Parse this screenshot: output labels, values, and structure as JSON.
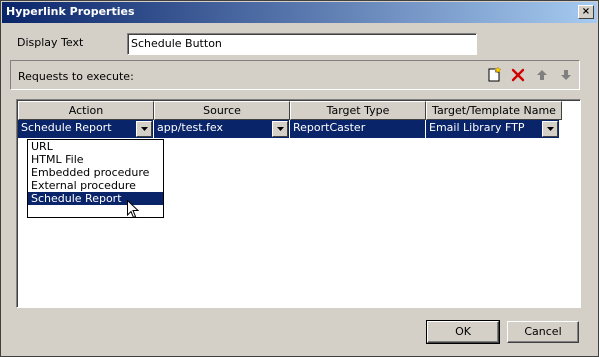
{
  "window": {
    "title": "Hyperlink Properties",
    "close_label": "×"
  },
  "display_text": {
    "label": "Display Text",
    "value": "Schedule Button"
  },
  "requests": {
    "label": "Requests to execute:",
    "toolbar_icons": [
      "new-request-icon",
      "delete-icon",
      "move-up-icon",
      "move-down-icon"
    ]
  },
  "grid": {
    "columns": [
      "Action",
      "Source",
      "Target Type",
      "Target/Template Name"
    ],
    "row": {
      "action": "Schedule Report",
      "source": "app/test.fex",
      "target_type": "ReportCaster",
      "target_name": "Email Library FTP"
    }
  },
  "action_dropdown": {
    "options": [
      "URL",
      "HTML File",
      "Embedded procedure",
      "External procedure",
      "Schedule Report"
    ],
    "selected": "Schedule Report"
  },
  "buttons": {
    "ok": "OK",
    "cancel": "Cancel"
  },
  "colors": {
    "selection": "#0a246a",
    "face": "#d4d0c8"
  }
}
